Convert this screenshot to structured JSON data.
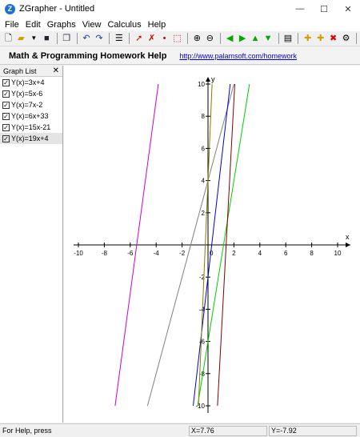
{
  "window": {
    "title": "ZGrapher - Untitled",
    "minimize": "—",
    "maximize": "☐",
    "close": "✕",
    "app_icon": "Z"
  },
  "menu": [
    {
      "label": "File"
    },
    {
      "label": "Edit"
    },
    {
      "label": "Graphs"
    },
    {
      "label": "View"
    },
    {
      "label": "Calculus"
    },
    {
      "label": "Help"
    }
  ],
  "ad": {
    "title": "Math & Programming Homework Help",
    "link": "http://www.palamsoft.com/homework"
  },
  "sidebar": {
    "title": "Graph List",
    "close": "✕",
    "items": [
      {
        "label": "Y(x)=3x+4"
      },
      {
        "label": "Y(x)=5x-6"
      },
      {
        "label": "Y(x)=7x-2"
      },
      {
        "label": "Y(x)=6x+33"
      },
      {
        "label": "Y(x)=15x-21"
      },
      {
        "label": "Y(x)=19x+4"
      }
    ]
  },
  "chart_data": {
    "type": "line",
    "xlabel": "x",
    "ylabel": "y",
    "xlim": [
      -10,
      10
    ],
    "ylim": [
      -10,
      10
    ],
    "x_ticks": [
      -10,
      -8,
      -6,
      -4,
      -2,
      2,
      4,
      6,
      8,
      10
    ],
    "y_ticks": [
      10,
      8,
      6,
      4,
      2,
      -2,
      -4,
      -6,
      -8,
      -10
    ],
    "origin_label": "0",
    "series": [
      {
        "name": "Y(x)=3x+4",
        "slope": 3,
        "intercept": 4,
        "color": "#808080"
      },
      {
        "name": "Y(x)=5x-6",
        "slope": 5,
        "intercept": -6,
        "color": "#00cc00"
      },
      {
        "name": "Y(x)=7x-2",
        "slope": 7,
        "intercept": -2,
        "color": "#0000cc"
      },
      {
        "name": "Y(x)=6x+33",
        "slope": 6,
        "intercept": 33,
        "color": "#cc00cc"
      },
      {
        "name": "Y(x)=15x-21",
        "slope": 15,
        "intercept": -21,
        "color": "#800000"
      },
      {
        "name": "Y(x)=19x+4",
        "slope": 19,
        "intercept": 4,
        "color": "#808000"
      }
    ]
  },
  "status": {
    "help": "For Help, press",
    "x": "X=7.76",
    "y": "Y=-7.92"
  }
}
